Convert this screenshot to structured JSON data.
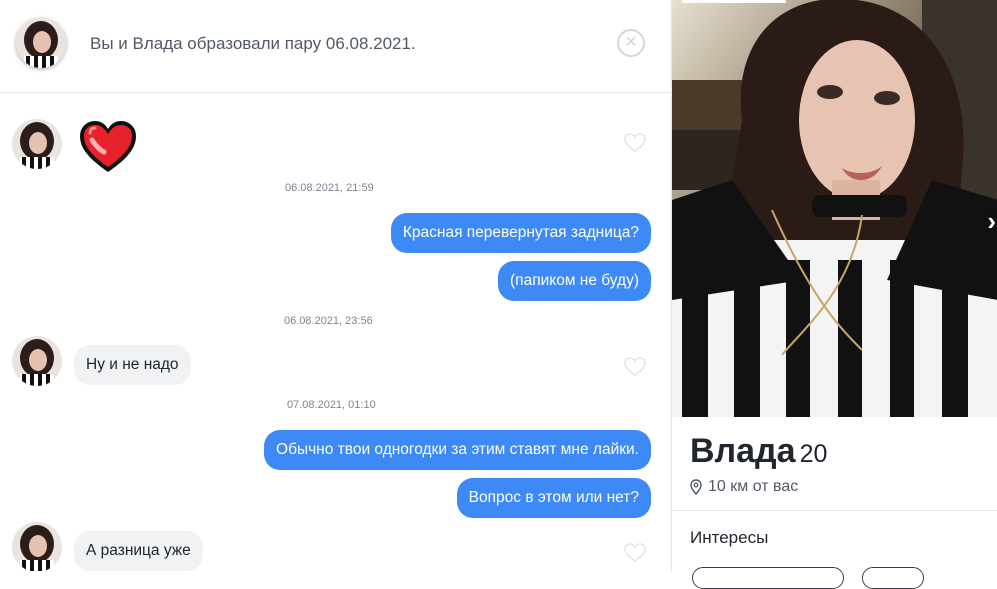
{
  "match": {
    "text": "Вы и Влада образовали пару 06.08.2021.",
    "close_icon": "×"
  },
  "messages": [
    {
      "id": "m1",
      "kind": "sticker",
      "sticker": "heart"
    },
    {
      "id": "t1",
      "kind": "timestamp",
      "text": "06.08.2021, 21:59"
    },
    {
      "id": "m2",
      "kind": "out",
      "text": "Красная перевернутая задница?"
    },
    {
      "id": "m3",
      "kind": "out",
      "text": "(папиком не буду)"
    },
    {
      "id": "t2",
      "kind": "timestamp",
      "text": "06.08.2021, 23:56"
    },
    {
      "id": "m4",
      "kind": "in",
      "text": "Ну и не надо"
    },
    {
      "id": "t3",
      "kind": "timestamp",
      "text": "07.08.2021, 01:10"
    },
    {
      "id": "m5",
      "kind": "out",
      "text": "Обычно твои одногодки за этим ставят мне лайки."
    },
    {
      "id": "m6",
      "kind": "out",
      "text": "Вопрос в этом или нет?"
    },
    {
      "id": "m7",
      "kind": "in",
      "text": "А разница уже"
    }
  ],
  "profile": {
    "name": "Влада",
    "age": "20",
    "distance": "10 км от вас",
    "interests_title": "Интересы",
    "next_photo_icon": "›"
  },
  "colors": {
    "outgoing": "#3d8af7",
    "incoming": "#f0f2f4",
    "heart": "#e8222b"
  },
  "icons": {
    "close": "close-icon",
    "like": "heart-outline-icon",
    "location": "location-pin-icon",
    "next": "chevron-right-icon"
  }
}
